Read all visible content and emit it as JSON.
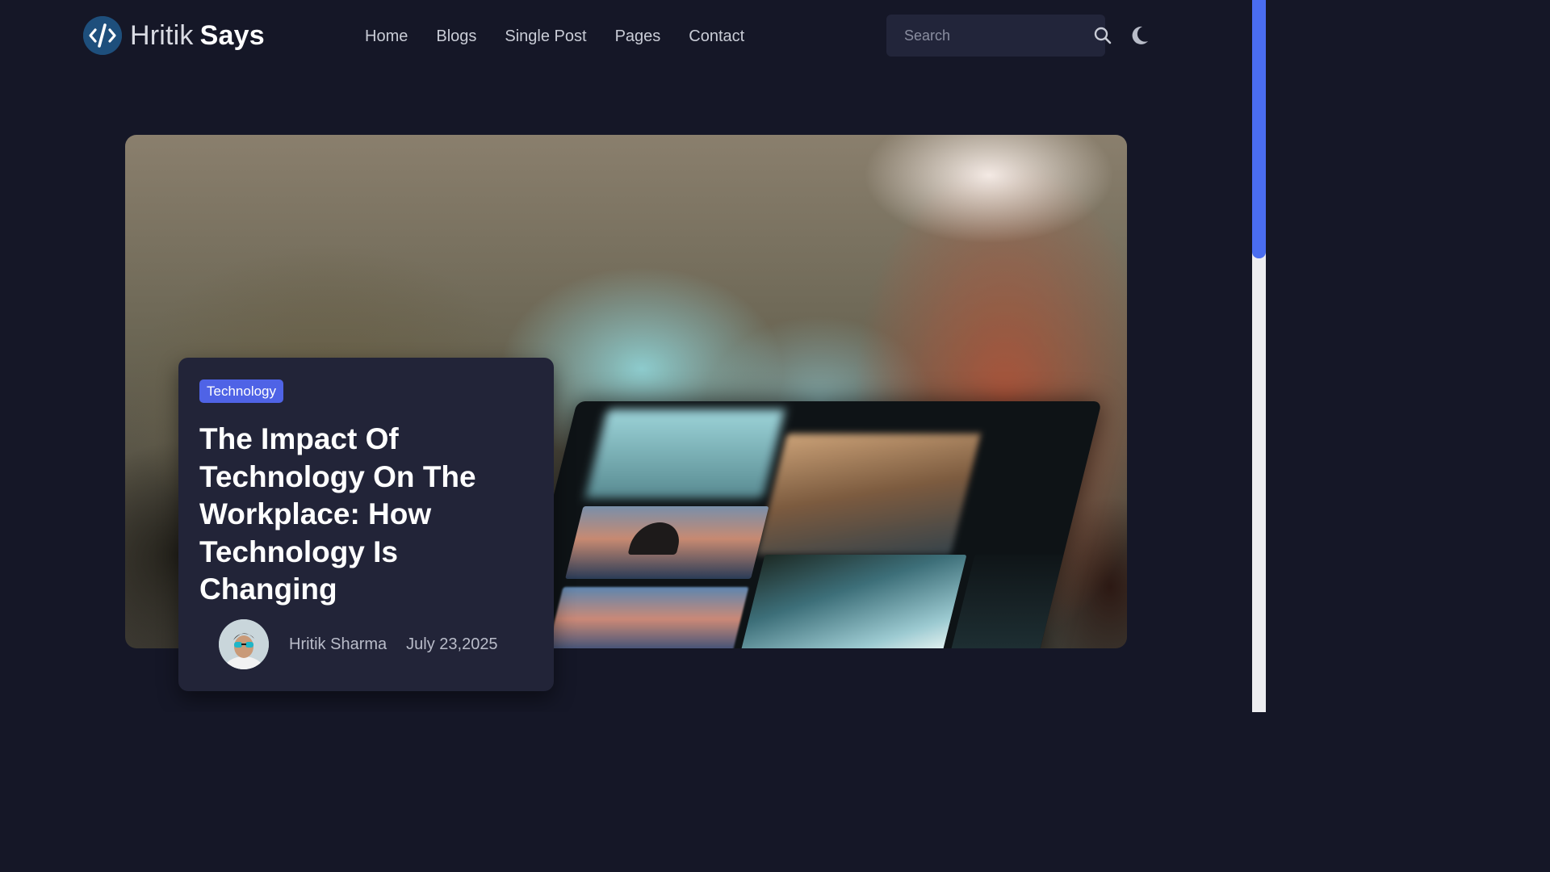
{
  "brand": {
    "name_light": "Hritik",
    "name_bold": "Says",
    "logo_icon": "code-slash-icon"
  },
  "nav": {
    "items": [
      {
        "label": "Home"
      },
      {
        "label": "Blogs"
      },
      {
        "label": "Single Post"
      },
      {
        "label": "Pages"
      },
      {
        "label": "Contact"
      }
    ]
  },
  "search": {
    "placeholder": "Search",
    "value": "",
    "icon": "search-icon"
  },
  "theme_toggle": {
    "icon": "moon-icon"
  },
  "featured_post": {
    "category": "Technology",
    "title": "The Impact Of Technology On The Workplace: How Technology Is Changing",
    "author": "Hritik Sharma",
    "date": "July 23,2025"
  },
  "colors": {
    "background": "#151727",
    "card": "#222438",
    "accent": "#4f63e6",
    "scrollbar_thumb": "#4a6df0"
  }
}
